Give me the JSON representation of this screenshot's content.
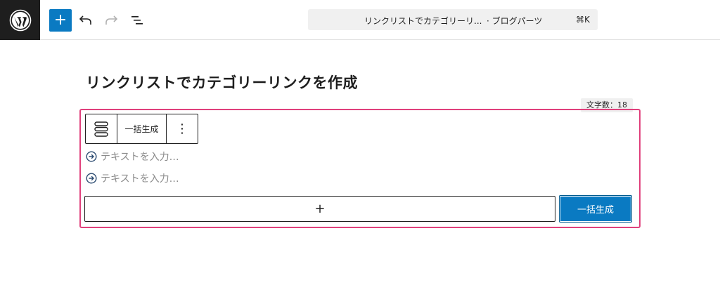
{
  "header": {
    "logo_icon": "wordpress-logo",
    "add_icon": "plus",
    "undo_icon": "undo-arrow",
    "redo_icon": "redo-arrow",
    "outline_icon": "document-outline",
    "command_bar": {
      "title": "リンクリストでカテゴリーリ...",
      "type": "· ブログパーツ",
      "shortcut": "⌘K"
    }
  },
  "post": {
    "title": "リンクリストでカテゴリーリンクを作成",
    "char_count": "文字数：18"
  },
  "block": {
    "toolbar": {
      "block_icon": "link-list-block",
      "generate_label": "一括生成",
      "more_label": "⋮"
    },
    "items": [
      {
        "icon": "arrow-circle-right",
        "placeholder": "テキストを入力…"
      },
      {
        "icon": "arrow-circle-right",
        "placeholder": "テキストを入力…"
      }
    ],
    "add_label": "+",
    "generate_button_label": "一括生成"
  },
  "colors": {
    "accent": "#0a7ac2",
    "highlight": "#e0407c",
    "topbar_logo_bg": "#1e1e1e"
  }
}
